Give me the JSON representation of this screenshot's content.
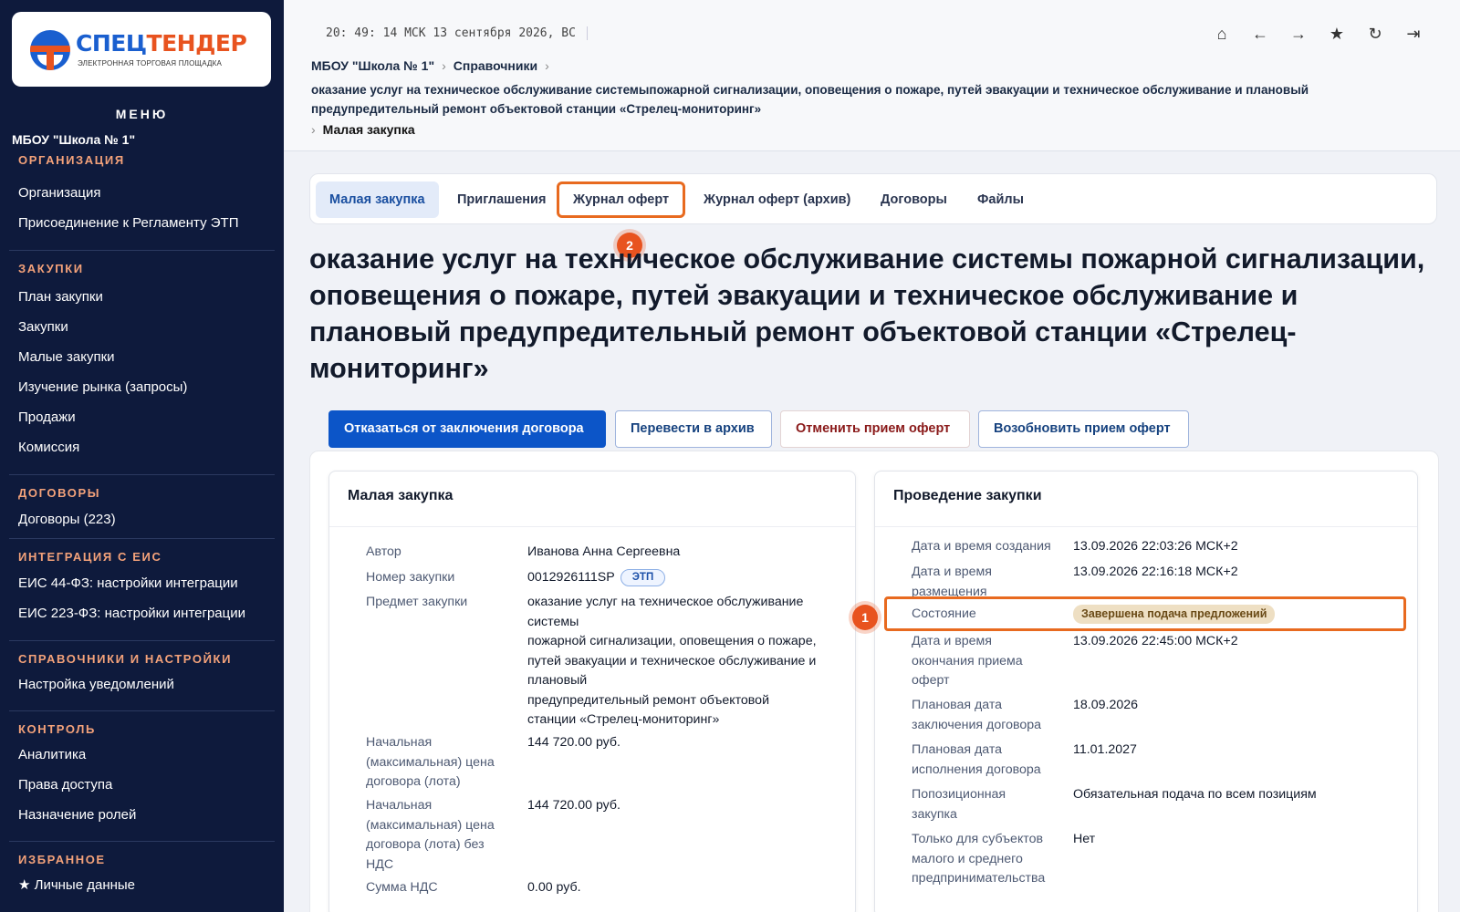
{
  "logo": {
    "part1": "СПЕЦ",
    "part2": "ТЕНДЕР",
    "subtitle": "ЭЛЕКТРОННАЯ ТОРГОВАЯ ПЛОЩАДКА"
  },
  "sidebar": {
    "menu_title": "МЕНЮ",
    "org_name": "МБОУ \"Школа № 1\"",
    "sections": [
      {
        "title": "ОРГАНИЗАЦИЯ",
        "items": [
          "Организация",
          "Присоединение к Регламенту ЭТП"
        ]
      },
      {
        "title": "ЗАКУПКИ",
        "items": [
          "План закупки",
          "Закупки",
          "Малые закупки",
          "Изучение рынка (запросы)",
          "Продажи",
          "Комиссия"
        ]
      },
      {
        "title": "ДОГОВОРЫ",
        "items": [
          "Договоры (223)"
        ]
      },
      {
        "title": "ИНТЕГРАЦИЯ С ЕИС",
        "items": [
          "ЕИС 44-ФЗ: настройки интеграции",
          "ЕИС 223-ФЗ: настройки интеграции"
        ]
      },
      {
        "title": "СПРАВОЧНИКИ И НАСТРОЙКИ",
        "items": [
          "Настройка уведомлений"
        ]
      },
      {
        "title": "КОНТРОЛЬ",
        "items": [
          "Аналитика",
          "Права доступа",
          "Назначение ролей"
        ]
      },
      {
        "title": "ИЗБРАННОЕ",
        "items": [
          "★ Личные данные"
        ]
      }
    ]
  },
  "topbar": {
    "clock": "20: 49: 14 МСК  13 сентября 2026, ВС",
    "icons": [
      "home-icon",
      "arrow-left-icon",
      "arrow-right-icon",
      "star-icon",
      "refresh-icon",
      "logout-icon"
    ]
  },
  "breadcrumb": {
    "org": "МБОУ \"Школа № 1\"",
    "section": "Справочники",
    "subject": "оказание услуг на техническое обслуживание системыпожарной сигнализации, оповещения о пожаре, путей эвакуации и техническое обслуживание и плановый предупредительный ремонт объектовой станции «Стрелец-мониторинг»",
    "current": "Малая закупка"
  },
  "tabs": [
    "Малая закупка",
    "Приглашения",
    "Журнал оферт",
    "Журнал оферт (архив)",
    "Договоры",
    "Файлы"
  ],
  "markers": {
    "one": "1",
    "two": "2"
  },
  "page_title": "оказание услуг на техническое обслуживание системы пожарной сигнализации, оповещения о пожаре, путей эвакуации и техническое обслуживание и плановый предупредительный ремонт объектовой станции «Стрелец-мониторинг»",
  "actions": {
    "decline": "Отказаться от заключения договора",
    "archive": "Перевести в архив",
    "cancel": "Отменить прием оферт",
    "resume": "Возобновить прием оферт"
  },
  "left_card": {
    "title": "Малая закупка",
    "author_label": "Автор",
    "author": "Иванова Анна Сергеевна",
    "number_label": "Номер закупки",
    "number": "0012926111SP",
    "number_tag": "ЭТП",
    "subject_label": "Предмет закупки",
    "subject_lines": [
      "оказание услуг на техническое обслуживание",
      "системы",
      "пожарной сигнализации, оповещения о пожаре,",
      "путей эвакуации и техническое обслуживание и",
      "плановый",
      "предупредительный ремонт объектовой",
      "станции «Стрелец-мониторинг»"
    ],
    "price_label_lines": [
      "Начальная",
      "(максимальная) цена",
      "договора (лота)"
    ],
    "price": "144 720.00 руб.",
    "price_novat_label_lines": [
      "Начальная",
      "(максимальная) цена",
      "договора (лота) без",
      "НДС"
    ],
    "price_novat": "144 720.00 руб.",
    "vat_label": "Сумма НДС",
    "vat": "0.00 руб."
  },
  "right_card": {
    "title": "Проведение закупки",
    "created_label": "Дата и время создания",
    "created": "13.09.2026 22:03:26 МСК+2",
    "placed_label_lines": [
      "Дата и время",
      "размещения"
    ],
    "placed": "13.09.2026 22:16:18 МСК+2",
    "state_label": "Состояние",
    "state": "Завершена подача предложений",
    "end_label_lines": [
      "Дата и время",
      "окончания приема",
      "оферт"
    ],
    "end": "13.09.2026 22:45:00 МСК+2",
    "contract_date_label_lines": [
      "Плановая дата",
      "заключения договора"
    ],
    "contract_date": "18.09.2026",
    "exec_date_label_lines": [
      "Плановая дата",
      "исполнения договора"
    ],
    "exec_date": "11.01.2027",
    "positional_label_lines": [
      "Попозиционная",
      "закупка"
    ],
    "positional": "Обязательная подача по всем позициям",
    "sme_label_lines": [
      "Только для субъектов",
      "малого и среднего",
      "предпринимательства"
    ],
    "sme": "Нет"
  },
  "colors": {
    "sidebar": "#0e1a3c",
    "accent": "#0c55c8",
    "highlight": "#e86a1f",
    "section": "#f4a27a"
  }
}
